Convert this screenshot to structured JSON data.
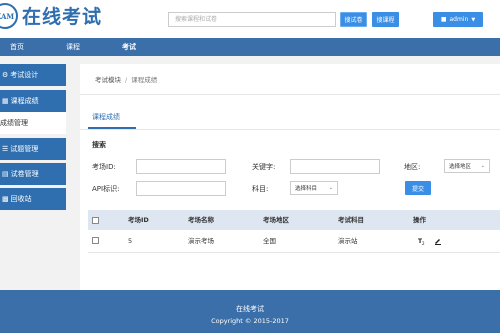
{
  "header": {
    "logo_badge": "XAM",
    "logo_text": "在线考试",
    "search_placeholder": "搜索课程和试卷",
    "btn_find_paper": "搜试卷",
    "btn_find_course": "搜课程",
    "user_label": "admin"
  },
  "nav": {
    "items": [
      {
        "label": "首页"
      },
      {
        "label": "课程"
      },
      {
        "label": "考试",
        "active": true
      }
    ]
  },
  "sidebar": {
    "items": [
      {
        "label": "考试设计",
        "icon": "gear-icon"
      },
      {
        "label": "课程成绩",
        "icon": "chart-icon"
      },
      {
        "label": "成绩管理",
        "sub": true
      },
      {
        "label": "试题管理",
        "icon": "list-icon"
      },
      {
        "label": "试卷管理",
        "icon": "doc-icon"
      },
      {
        "label": "回收站",
        "icon": "trash-icon"
      }
    ]
  },
  "breadcrumb": {
    "parent": "考试模块",
    "separator": "/",
    "current": "课程成绩"
  },
  "tab": {
    "label": "课程成绩"
  },
  "search_form": {
    "title": "搜索",
    "exam_id_label": "考场ID:",
    "keyword_label": "关键字:",
    "region_label": "地区:",
    "region_value": "选择地区",
    "api_label": "API标识:",
    "subject_label": "科目:",
    "subject_value": "选择科目",
    "submit_label": "提交"
  },
  "table": {
    "headers": [
      "考场ID",
      "考场名称",
      "考场地区",
      "考试科目",
      "操作"
    ],
    "rows": [
      {
        "id": "5",
        "name": "演示考场",
        "region": "全国",
        "subject": "演示站"
      }
    ]
  },
  "footer": {
    "title": "在线考试",
    "copyright": "Copyright © 2015-2017"
  }
}
